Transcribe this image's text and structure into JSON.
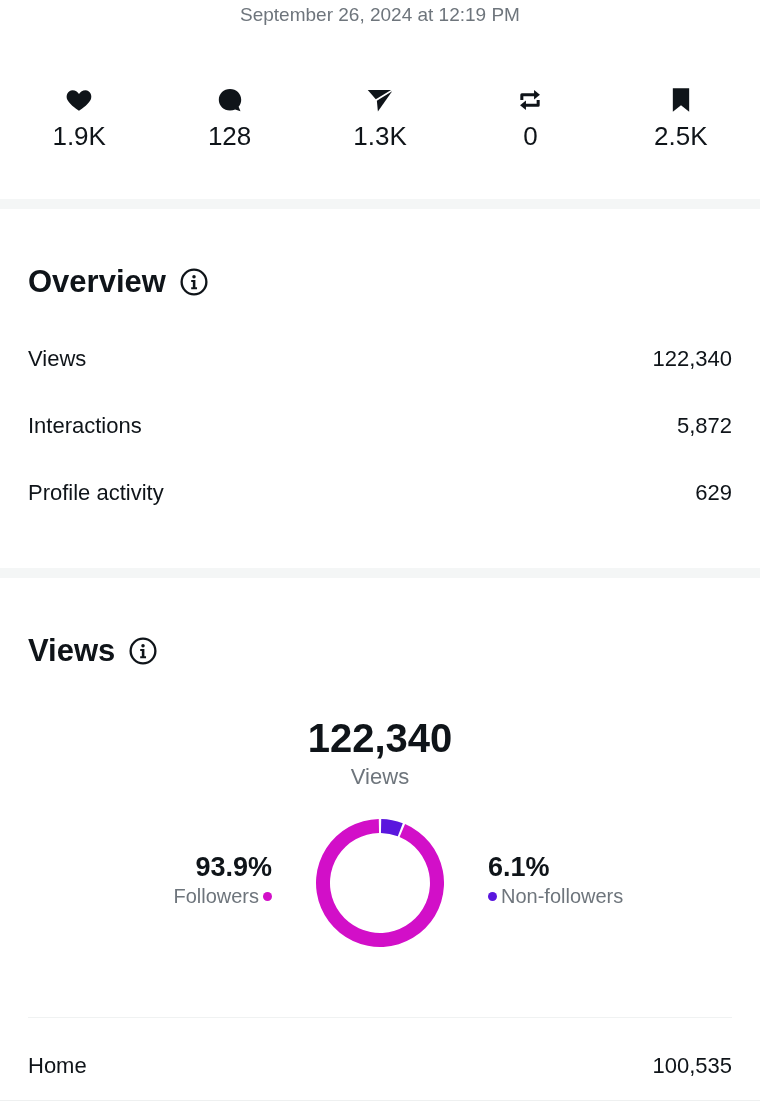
{
  "date": "September 26, 2024 at 12:19 PM",
  "stats": [
    {
      "kind": "likes",
      "count": "1.9K"
    },
    {
      "kind": "comments",
      "count": "128"
    },
    {
      "kind": "shares",
      "count": "1.3K"
    },
    {
      "kind": "reposts",
      "count": "0"
    },
    {
      "kind": "saves",
      "count": "2.5K"
    }
  ],
  "overview": {
    "title": "Overview",
    "rows": [
      {
        "label": "Views",
        "value": "122,340"
      },
      {
        "label": "Interactions",
        "value": "5,872"
      },
      {
        "label": "Profile activity",
        "value": "629"
      }
    ]
  },
  "views": {
    "title": "Views",
    "total": "122,340",
    "total_label": "Views",
    "legend": [
      {
        "value": "93.9%",
        "label": "Followers",
        "color": "#d20fc8"
      },
      {
        "value": "6.1%",
        "label": "Non-followers",
        "color": "#5a16de"
      }
    ],
    "chart_data": {
      "type": "donut",
      "values": [
        93.9,
        6.1
      ]
    },
    "sources": [
      {
        "label": "Home",
        "value": "100,535"
      }
    ]
  }
}
